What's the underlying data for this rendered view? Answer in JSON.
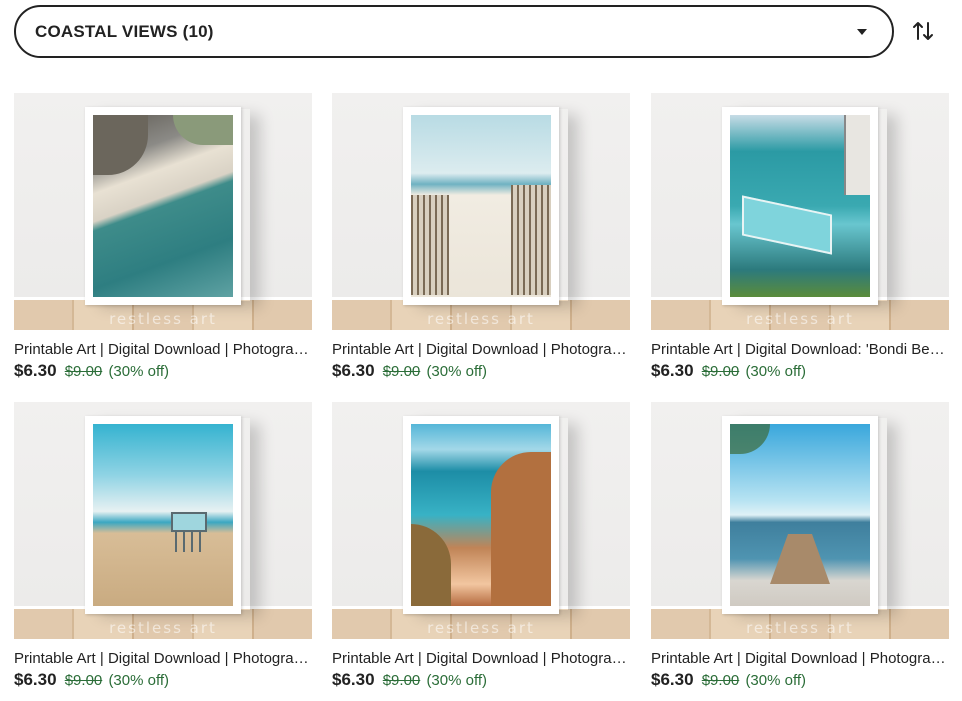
{
  "filter": {
    "label": "COASTAL VIEWS (10)",
    "icon": "chevron-down-icon"
  },
  "sort": {
    "icon": "sort-arrows-icon"
  },
  "watermark": "restless art",
  "products": [
    {
      "title": "Printable Art | Digital Download | Photography Print",
      "price": "$6.30",
      "original_price": "$9.00",
      "discount": "(30% off)"
    },
    {
      "title": "Printable Art | Digital Download | Photography Print",
      "price": "$6.30",
      "original_price": "$9.00",
      "discount": "(30% off)"
    },
    {
      "title": "Printable Art | Digital Download: 'Bondi Beach'",
      "price": "$6.30",
      "original_price": "$9.00",
      "discount": "(30% off)"
    },
    {
      "title": "Printable Art | Digital Download | Photography Print",
      "price": "$6.30",
      "original_price": "$9.00",
      "discount": "(30% off)"
    },
    {
      "title": "Printable Art | Digital Download | Photography Print",
      "price": "$6.30",
      "original_price": "$9.00",
      "discount": "(30% off)"
    },
    {
      "title": "Printable Art | Digital Download | Photography Print",
      "price": "$6.30",
      "original_price": "$9.00",
      "discount": "(30% off)"
    }
  ]
}
